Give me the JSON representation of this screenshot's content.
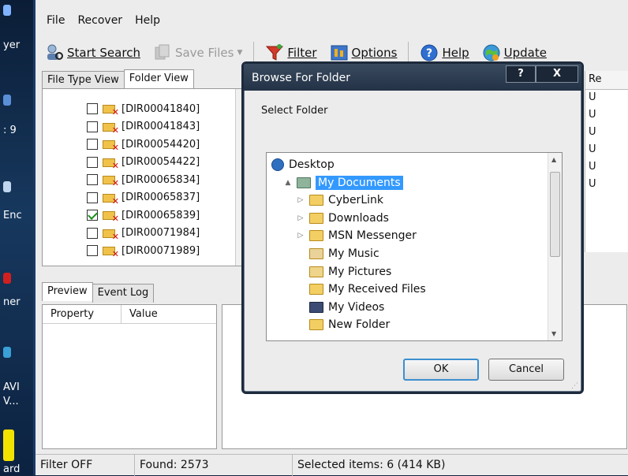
{
  "desktop": {
    "labels": [
      "yer",
      ": 9",
      "Enc",
      "ner",
      "AVI",
      "V...",
      "ard"
    ]
  },
  "menu": {
    "items": [
      "File",
      "Recover",
      "Help"
    ]
  },
  "toolbar": {
    "start_search": "Start Search",
    "save_files": "Save Files",
    "filter": "Filter",
    "options": "Options",
    "help": "Help",
    "update": "Update"
  },
  "tabs_top": [
    "File Type View",
    "Folder View"
  ],
  "tree": {
    "rows": [
      {
        "label": "[DIR00041840]",
        "checked": false
      },
      {
        "label": "[DIR00041843]",
        "checked": false
      },
      {
        "label": "[DIR00054420]",
        "checked": false
      },
      {
        "label": "[DIR00054422]",
        "checked": false
      },
      {
        "label": "[DIR00065834]",
        "checked": false
      },
      {
        "label": "[DIR00065837]",
        "checked": false
      },
      {
        "label": "[DIR00065839]",
        "checked": true
      },
      {
        "label": "[DIR00071984]",
        "checked": false
      },
      {
        "label": "[DIR00071989]",
        "checked": false
      }
    ]
  },
  "right_list": {
    "header": "Re",
    "cells": [
      "U",
      "U",
      "U",
      "U",
      "U",
      "U"
    ]
  },
  "tabs_bottom": [
    "Preview",
    "Event Log"
  ],
  "properties": {
    "col_property": "Property",
    "col_value": "Value"
  },
  "status": {
    "filter": "Filter OFF",
    "found": "Found: 2573",
    "selected": "Selected items: 6 (414 KB)"
  },
  "dialog": {
    "title": "Browse For Folder",
    "help_btn": "?",
    "close_btn": "X",
    "label": "Select Folder",
    "folders": [
      {
        "name": "Desktop",
        "icon": "desktop-icon",
        "level": 0,
        "expander": ""
      },
      {
        "name": "My Documents",
        "icon": "my-documents-icon",
        "level": 1,
        "expander": "▲",
        "selected": true
      },
      {
        "name": "CyberLink",
        "icon": "folder-icon",
        "level": 2,
        "expander": "▷"
      },
      {
        "name": "Downloads",
        "icon": "folder-icon",
        "level": 2,
        "expander": "▷"
      },
      {
        "name": "MSN Messenger",
        "icon": "folder-icon",
        "level": 2,
        "expander": "▷"
      },
      {
        "name": "My Music",
        "icon": "music-folder-icon",
        "level": 2,
        "expander": ""
      },
      {
        "name": "My Pictures",
        "icon": "pictures-folder-icon",
        "level": 2,
        "expander": ""
      },
      {
        "name": "My Received Files",
        "icon": "folder-icon",
        "level": 2,
        "expander": ""
      },
      {
        "name": "My Videos",
        "icon": "videos-folder-icon",
        "level": 2,
        "expander": ""
      },
      {
        "name": "New Folder",
        "icon": "folder-icon",
        "level": 2,
        "expander": ""
      }
    ],
    "ok": "OK",
    "cancel": "Cancel"
  },
  "colors": {
    "selection": "#3399ff",
    "title_bar": "#233246",
    "check_green": "#1a8f1a",
    "error_red": "#d01010"
  }
}
